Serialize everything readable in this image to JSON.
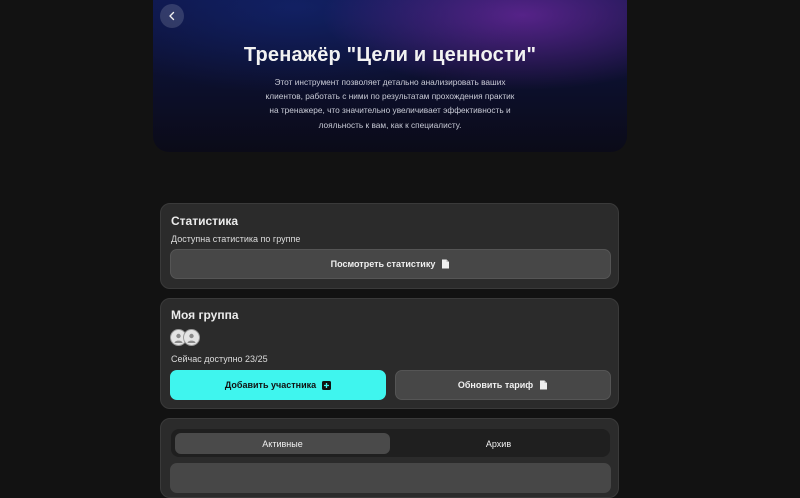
{
  "hero": {
    "title": "Тренажёр \"Цели и ценности\"",
    "description": "Этот инструмент позволяет детально анализировать ваших клиентов, работать с ними по результатам прохождения практик на тренажере, что значительно увеличивает эффективность и лояльность к вам, как к специалисту."
  },
  "stats": {
    "title": "Статистика",
    "subtitle": "Доступна статистика по группе",
    "view_button": "Посмотреть статистику"
  },
  "group": {
    "title": "Моя группа",
    "available": "Сейчас доступно 23/25",
    "add_button": "Добавить участника",
    "upgrade_button": "Обновить тариф"
  },
  "tabs": {
    "active": "Активные",
    "archive": "Архив"
  },
  "colors": {
    "accent": "#3ff5ee",
    "page_bg": "#121212",
    "card_bg": "#2b2b2b"
  }
}
